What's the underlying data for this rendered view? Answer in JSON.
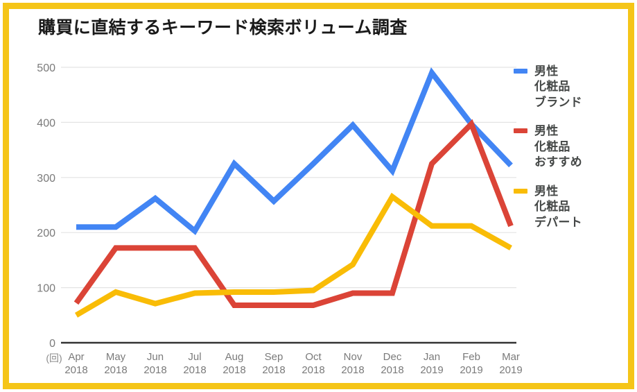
{
  "title": "購買に直結するキーワード検索ボリューム調査",
  "frame": {
    "color": "#F5C518"
  },
  "axis": {
    "unit_label": "(回)",
    "y_ticks": [
      "0",
      "100",
      "200",
      "300",
      "400",
      "500"
    ],
    "x_labels": [
      {
        "month": "Apr",
        "year": "2018"
      },
      {
        "month": "May",
        "year": "2018"
      },
      {
        "month": "Jun",
        "year": "2018"
      },
      {
        "month": "Jul",
        "year": "2018"
      },
      {
        "month": "Aug",
        "year": "2018"
      },
      {
        "month": "Sep",
        "year": "2018"
      },
      {
        "month": "Oct",
        "year": "2018"
      },
      {
        "month": "Nov",
        "year": "2018"
      },
      {
        "month": "Dec",
        "year": "2018"
      },
      {
        "month": "Jan",
        "year": "2019"
      },
      {
        "month": "Feb",
        "year": "2019"
      },
      {
        "month": "Mar",
        "year": "2019"
      }
    ]
  },
  "legend": {
    "position": "right",
    "items": [
      {
        "label": "男性\n化粧品\nブランド",
        "color": "#4285F4"
      },
      {
        "label": "男性\n化粧品\nおすすめ",
        "color": "#DB4437"
      },
      {
        "label": "男性\n化粧品\nデパート",
        "color": "#F9BC06"
      }
    ]
  },
  "chart_data": {
    "type": "line",
    "title": "購買に直結するキーワード検索ボリューム調査",
    "xlabel": "",
    "ylabel": "(回)",
    "ylim": [
      0,
      500
    ],
    "yticks": [
      0,
      100,
      200,
      300,
      400,
      500
    ],
    "grid": true,
    "legend_position": "right",
    "categories": [
      "Apr 2018",
      "May 2018",
      "Jun 2018",
      "Jul 2018",
      "Aug 2018",
      "Sep 2018",
      "Oct 2018",
      "Nov 2018",
      "Dec 2018",
      "Jan 2019",
      "Feb 2019",
      "Mar 2019"
    ],
    "series": [
      {
        "name": "男性化粧品ブランド",
        "color": "#4285F4",
        "values": [
          210,
          210,
          262,
          203,
          325,
          257,
          325,
          395,
          312,
          490,
          397,
          322
        ]
      },
      {
        "name": "男性化粧品おすすめ",
        "color": "#DB4437",
        "values": [
          72,
          172,
          172,
          172,
          68,
          68,
          68,
          90,
          90,
          325,
          397,
          212
        ]
      },
      {
        "name": "男性化粧品デパート",
        "color": "#F9BC06",
        "values": [
          50,
          92,
          71,
          90,
          92,
          92,
          95,
          142,
          265,
          212,
          212,
          172
        ]
      }
    ]
  }
}
